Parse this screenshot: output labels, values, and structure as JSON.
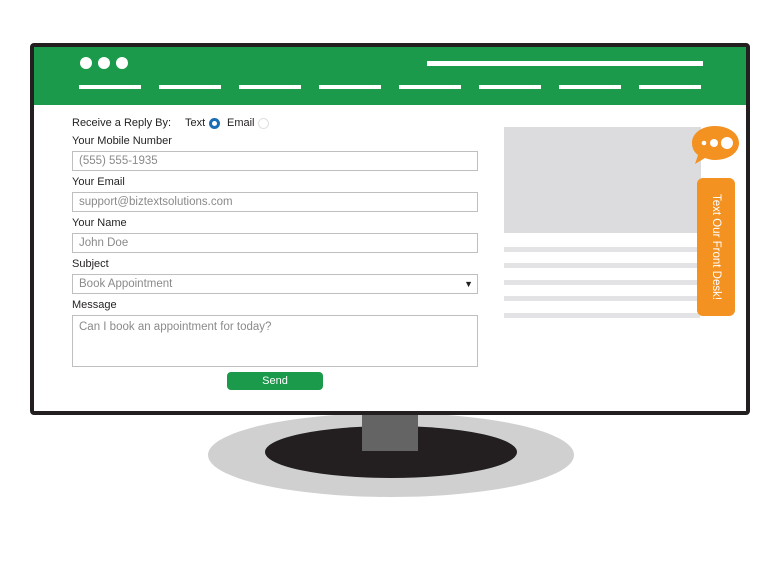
{
  "form": {
    "reply_by_label": "Receive a Reply By:",
    "reply_options": [
      "Text",
      "Email"
    ],
    "reply_selected": "Text",
    "mobile_label": "Your Mobile Number",
    "mobile_value": "(555) 555-1935",
    "email_label": "Your Email",
    "email_value": "support@biztextsolutions.com",
    "name_label": "Your Name",
    "name_value": "John Doe",
    "subject_label": "Subject",
    "subject_value": "Book Appointment",
    "message_label": "Message",
    "message_value": "Can I book an appointment for today?",
    "send_label": "Send"
  },
  "widget": {
    "tab_label": "Text Our Front Desk!"
  },
  "colors": {
    "header_green": "#1a9a4a",
    "widget_orange": "#f39121",
    "radio_blue": "#1b6db6"
  }
}
